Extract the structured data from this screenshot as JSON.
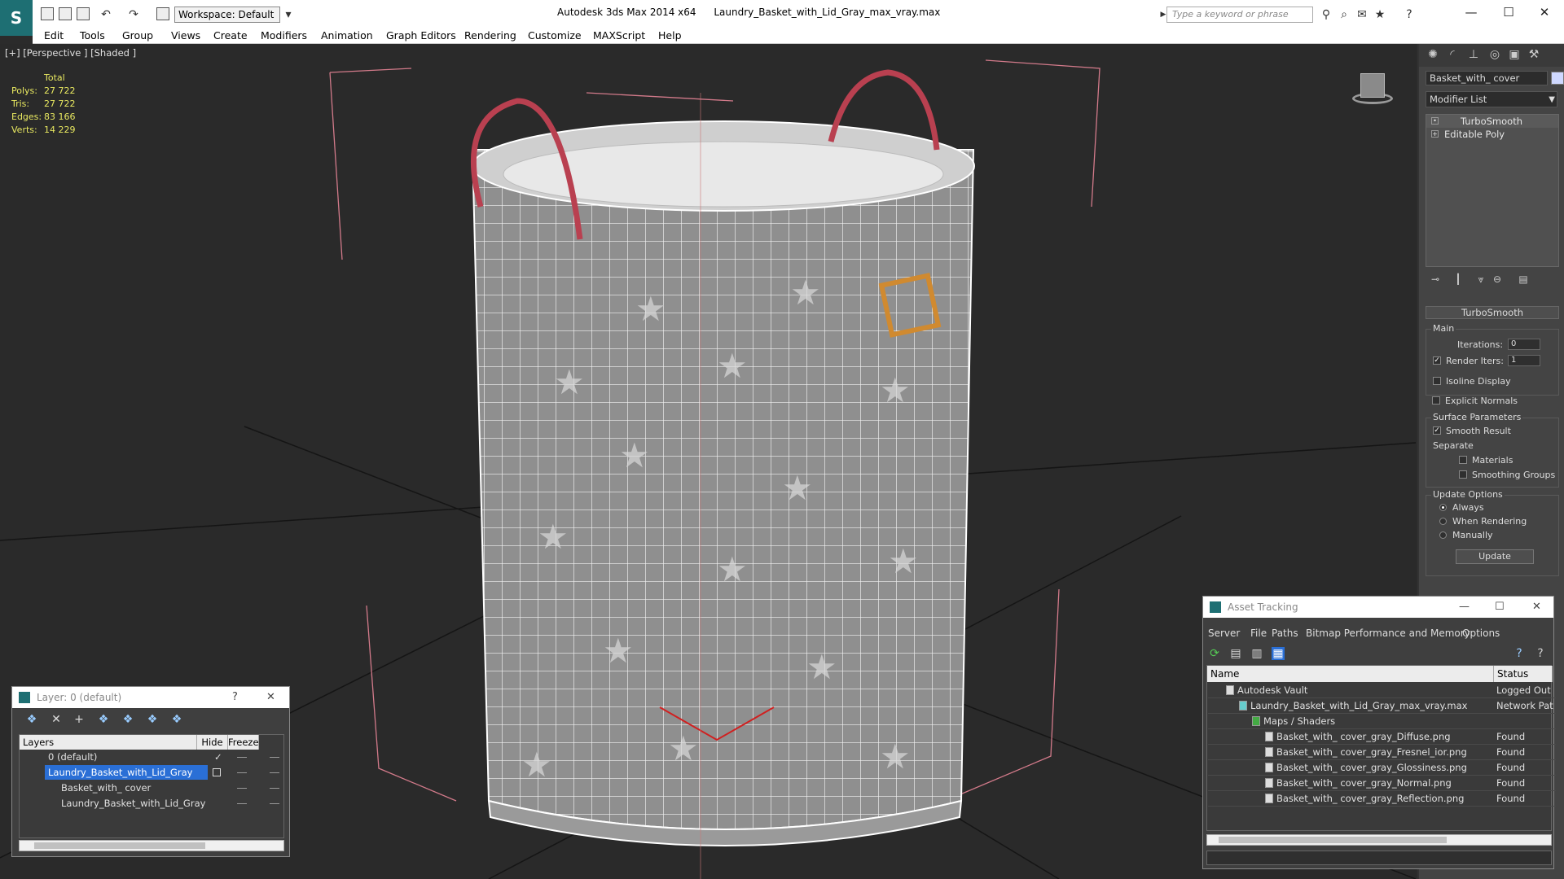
{
  "app": {
    "title": "Autodesk 3ds Max  2014 x64",
    "file": "Laundry_Basket_with_Lid_Gray_max_vray.max",
    "workspace": "Workspace: Default",
    "search_placeholder": "Type a keyword or phrase"
  },
  "menu": [
    "Edit",
    "Tools",
    "Group",
    "Views",
    "Create",
    "Modifiers",
    "Animation",
    "Graph Editors",
    "Rendering",
    "Customize",
    "MAXScript",
    "Help"
  ],
  "viewport": {
    "label": "[+] [Perspective ] [Shaded ]",
    "stats": {
      "total_label": "Total",
      "rows": [
        {
          "k": "Polys:",
          "v": "27 722"
        },
        {
          "k": "Tris:",
          "v": "27 722"
        },
        {
          "k": "Edges:",
          "v": "83 166"
        },
        {
          "k": "Verts:",
          "v": "14 229"
        }
      ]
    }
  },
  "command_panel": {
    "object_name": "Basket_with_ cover",
    "modifier_list": "Modifier List",
    "stack": [
      "TurboSmooth",
      "Editable Poly"
    ],
    "rollout_title": "TurboSmooth",
    "main_group": "Main",
    "iterations_label": "Iterations:",
    "iterations_value": "0",
    "render_iters_label": "Render Iters:",
    "render_iters_value": "1",
    "isoline_label": "Isoline Display",
    "explicit_label": "Explicit Normals",
    "surface_group": "Surface Parameters",
    "smooth_result_label": "Smooth Result",
    "separate_label": "Separate",
    "materials_label": "Materials",
    "smoothing_groups_label": "Smoothing Groups",
    "update_group": "Update Options",
    "always_label": "Always",
    "when_rendering_label": "When Rendering",
    "manually_label": "Manually",
    "update_button": "Update"
  },
  "layer_dialog": {
    "title": "Layer: 0 (default)",
    "help": "?",
    "col_layers": "Layers",
    "col_hide": "Hide",
    "col_freeze": "Freeze",
    "rows": [
      {
        "name": "0 (default)"
      },
      {
        "name": "Laundry_Basket_with_Lid_Gray"
      },
      {
        "name": "Basket_with_ cover"
      },
      {
        "name": "Laundry_Basket_with_Lid_Gray"
      }
    ]
  },
  "asset_tracking": {
    "title": "Asset Tracking",
    "menu": [
      "Server",
      "File",
      "Paths",
      "Bitmap Performance and Memory",
      "Options"
    ],
    "col_name": "Name",
    "col_status": "Status",
    "rows": [
      {
        "name": "Autodesk Vault",
        "status": "Logged Out"
      },
      {
        "name": "Laundry_Basket_with_Lid_Gray_max_vray.max",
        "status": "Network Pat"
      },
      {
        "name": "Maps / Shaders",
        "status": ""
      },
      {
        "name": "Basket_with_ cover_gray_Diffuse.png",
        "status": "Found"
      },
      {
        "name": "Basket_with_ cover_gray_Fresnel_ior.png",
        "status": "Found"
      },
      {
        "name": "Basket_with_ cover_gray_Glossiness.png",
        "status": "Found"
      },
      {
        "name": "Basket_with_ cover_gray_Normal.png",
        "status": "Found"
      },
      {
        "name": "Basket_with_ cover_gray_Reflection.png",
        "status": "Found"
      }
    ]
  }
}
